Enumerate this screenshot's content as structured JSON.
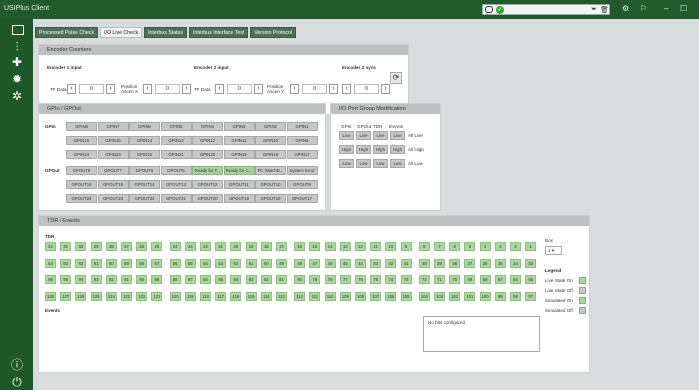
{
  "app": {
    "title": "USIPlus Client"
  },
  "titlebar": {
    "status_ok": "✓",
    "filter": "⏷",
    "trash": "🗑",
    "gear": "⚙",
    "flag": "⚐",
    "minimize": "–",
    "maximize": "☐"
  },
  "tabs": [
    "Processed Pulse Check",
    "I/O Live Check",
    "Interbus Status",
    "Interbus Interface Test",
    "Version Protocol"
  ],
  "encoder": {
    "header": "Encoder Counters",
    "input1": {
      "title": "Encoder 1 input",
      "tf_label": "TF Data",
      "tf_value": "0",
      "pos_label": "Position Ascen X",
      "pos_value": "0"
    },
    "input2": {
      "title": "Encoder 2 input",
      "tf_label": "TF Data",
      "tf_value": "0",
      "pos_label": "Position Ascen Y",
      "pos_value": "0"
    },
    "sync": {
      "title": "Encoder Z sync",
      "value": "0"
    },
    "reset_icon": "⟳"
  },
  "gpio": {
    "header": "GPIn / GPOut",
    "gpin_label": "GPIn",
    "gpout_label": "GPOut",
    "gpin_rows": [
      [
        "GPIN8",
        "GPIN7",
        "GPIN6",
        "GPIN5",
        "GPIN4",
        "GPIN3",
        "GPIN2",
        "GPIN1"
      ],
      [
        "GPIN16",
        "GPIN15",
        "GPIN14",
        "GPIN13",
        "GPIN12",
        "GPIN11",
        "GPIN10",
        "GPIN9"
      ],
      [
        "GPIN24",
        "GPIN23",
        "GPIN22",
        "GPIN21",
        "GPIN20",
        "GPIN19",
        "GPIN18",
        "GPIN17"
      ]
    ],
    "gpout_rows": [
      [
        "GPOUT8",
        "GPOUT7",
        "GPOUT6",
        "GPOUT5",
        "Ready for T...",
        "Ready for C...",
        "PC WatchD...",
        "System Error"
      ],
      [
        "GPOUT16",
        "GPOUT15",
        "GPOUT14",
        "GPOUT13",
        "GPOUT12",
        "GPOUT11",
        "GPOUT10",
        "GPOUT9"
      ],
      [
        "GPOUT24",
        "GPOUT23",
        "GPOUT22",
        "GPOUT21",
        "GPOUT20",
        "GPOUT19",
        "GPOUT18",
        "GPOUT17"
      ]
    ],
    "gpout_active": [
      [
        false,
        false,
        false,
        false,
        true,
        true,
        false,
        false
      ],
      [
        false,
        false,
        false,
        false,
        false,
        false,
        false,
        false
      ],
      [
        false,
        false,
        false,
        false,
        false,
        false,
        false,
        false
      ]
    ]
  },
  "port_group": {
    "header": "I/O Port Group Modification",
    "columns": [
      "GPIn",
      "GPOut",
      "TDR",
      "Events"
    ],
    "rows": [
      {
        "cells": [
          "Live",
          "Live",
          "Live",
          "Live"
        ],
        "all": "All Live"
      },
      {
        "cells": [
          "High",
          "High",
          "High",
          "High"
        ],
        "all": "All High"
      },
      {
        "cells": [
          "Low",
          "Low",
          "Low",
          "Low"
        ],
        "all": "All Low"
      }
    ]
  },
  "tdr_events": {
    "header": "TDR / Events",
    "tdr_label": "TDR",
    "events_label": "Events",
    "rows": [
      [
        "32",
        "31",
        "30",
        "29",
        "28",
        "27",
        "26",
        "25",
        "24",
        "23",
        "22",
        "21",
        "20",
        "19",
        "18",
        "17",
        "16",
        "15",
        "14",
        "13",
        "12",
        "11",
        "10",
        "9",
        "8",
        "7",
        "6",
        "5",
        "4",
        "3",
        "2",
        "1"
      ],
      [
        "64",
        "63",
        "62",
        "61",
        "60",
        "59",
        "58",
        "57",
        "56",
        "55",
        "54",
        "53",
        "52",
        "51",
        "50",
        "49",
        "48",
        "47",
        "46",
        "45",
        "44",
        "43",
        "42",
        "41",
        "40",
        "39",
        "38",
        "37",
        "36",
        "35",
        "34",
        "33"
      ],
      [
        "96",
        "95",
        "94",
        "93",
        "92",
        "91",
        "90",
        "89",
        "88",
        "87",
        "86",
        "85",
        "84",
        "83",
        "82",
        "81",
        "80",
        "79",
        "78",
        "77",
        "76",
        "75",
        "74",
        "73",
        "72",
        "71",
        "70",
        "69",
        "68",
        "67",
        "66",
        "65"
      ],
      [
        "128",
        "127",
        "126",
        "125",
        "124",
        "123",
        "122",
        "121",
        "120",
        "119",
        "118",
        "117",
        "116",
        "115",
        "114",
        "113",
        "112",
        "111",
        "110",
        "109",
        "108",
        "107",
        "106",
        "105",
        "104",
        "103",
        "102",
        "101",
        "100",
        "99",
        "98",
        "97"
      ]
    ],
    "box_label": "Box",
    "box_value": "1",
    "legend_title": "Legend",
    "legend": [
      {
        "label": "Live State On",
        "color": "#a8d89a"
      },
      {
        "label": "Live State Off",
        "color": "#c6c8c8"
      },
      {
        "label": "Simulated On",
        "color": "#a8d89a"
      },
      {
        "label": "Simulated Off",
        "color": "#c6c8c8"
      }
    ],
    "no_bits": "No bits configured"
  },
  "sidebar": {
    "screen": "",
    "sliders": "⫶",
    "io": "✚",
    "bug": "✹",
    "gear": "✲",
    "info": "ⓘ",
    "power": "⏻"
  }
}
